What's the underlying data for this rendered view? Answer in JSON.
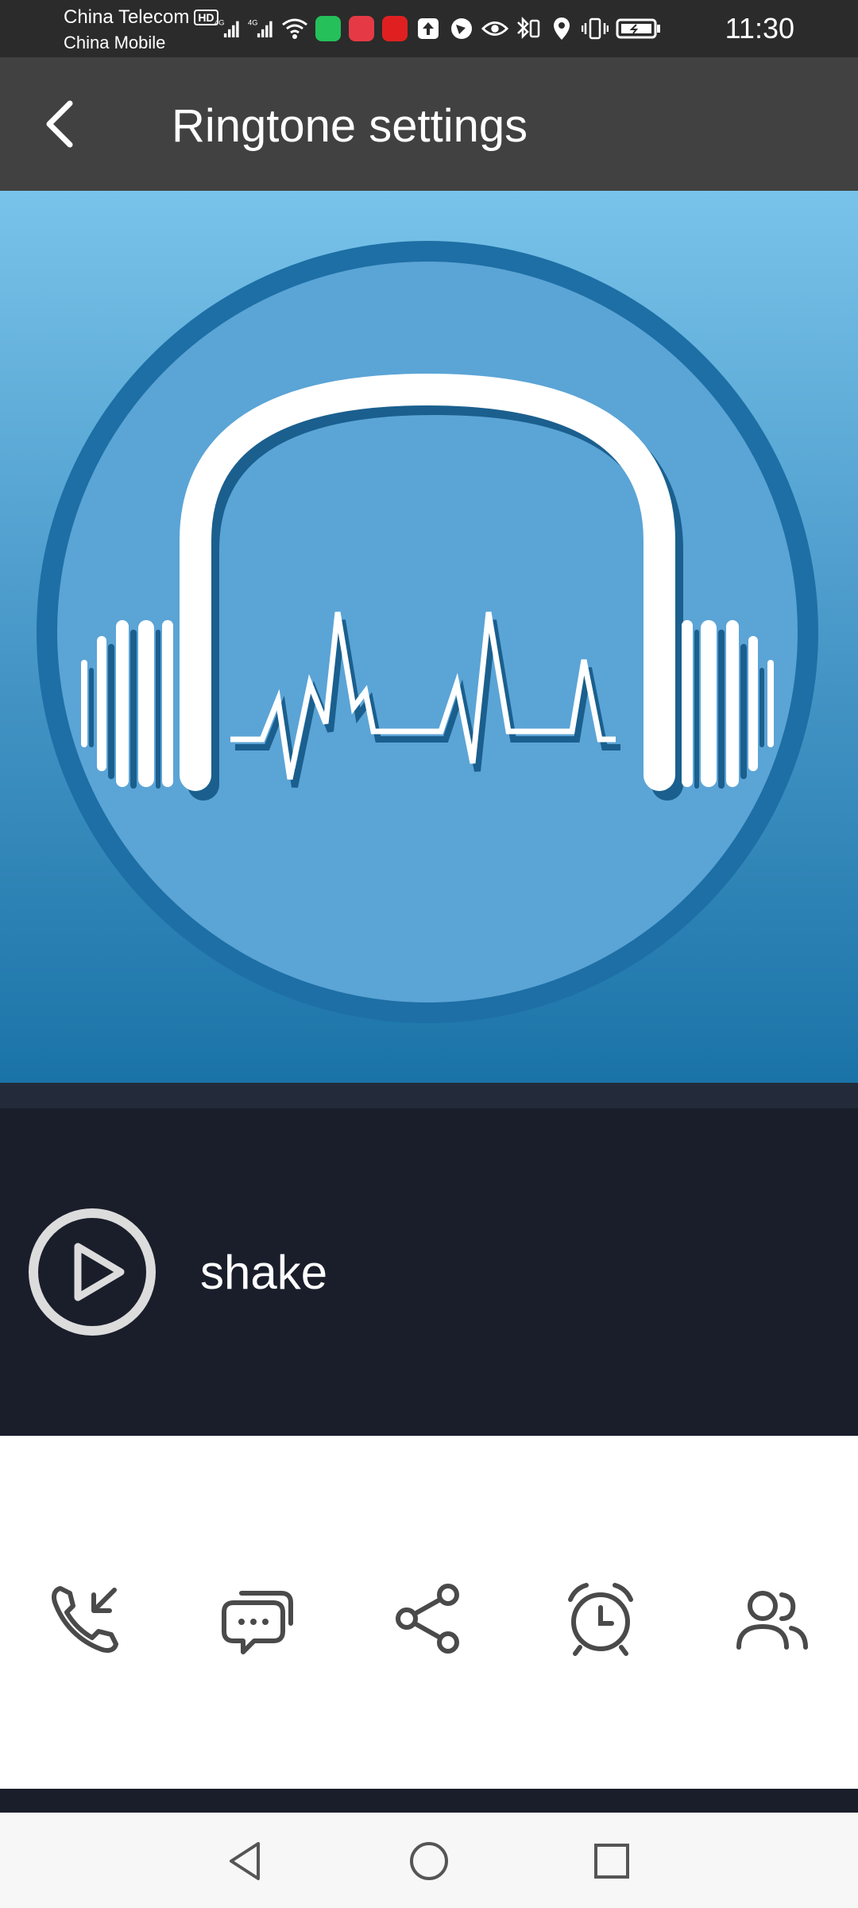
{
  "status_bar": {
    "carrier_1": "China Telecom",
    "hd_badge": "HD",
    "carrier_2": "China Mobile",
    "network_1": "4G",
    "network_2": "4G",
    "time": "11:30"
  },
  "header": {
    "title": "Ringtone settings",
    "back_icon": "back-arrow-icon"
  },
  "artwork": {
    "icon": "headphones-waveform-icon"
  },
  "player": {
    "play_icon": "play-icon",
    "ringtone_name": "shake"
  },
  "actions": [
    {
      "icon": "incoming-call-icon"
    },
    {
      "icon": "sms-message-icon"
    },
    {
      "icon": "share-icon"
    },
    {
      "icon": "alarm-clock-icon"
    },
    {
      "icon": "contacts-icon"
    }
  ],
  "nav": {
    "back_icon": "nav-back-icon",
    "home_icon": "nav-home-icon",
    "recents_icon": "nav-recents-icon"
  },
  "colors": {
    "status_bar_bg": "#2b2b2b",
    "app_bar_bg": "#414141",
    "player_bg": "#1a1e2b",
    "artwork_blue": "#5ba4d6",
    "artwork_ring": "#1d6fa5",
    "icon_gray": "#4a4a4a"
  }
}
